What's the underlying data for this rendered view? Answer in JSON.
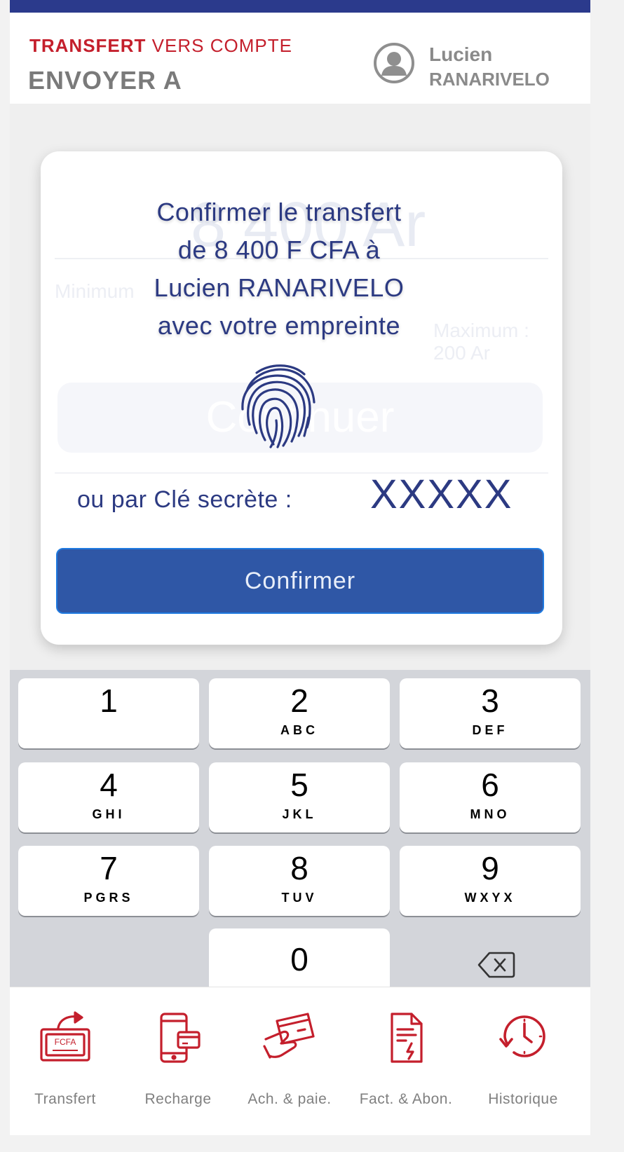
{
  "header": {
    "title_strong": "TRANSFERT",
    "title_light": "VERS COMPTE",
    "subtitle": "ENVOYER A",
    "recipient_first": "Lucien",
    "recipient_last": "RANARIVELO"
  },
  "modal": {
    "confirm_line1": "Confirmer le transfert",
    "confirm_line2": "de 8 400 F CFA à",
    "confirm_line3": "Lucien RANARIVELO",
    "confirm_line4": "avec votre empreinte",
    "secret_label": "ou par Clé secrète :",
    "secret_value": "XXXXX",
    "confirm_button": "Confirmer"
  },
  "background_form": {
    "amount_text": "8 400 Ar",
    "min_text": "Minimum",
    "max_text": "Maximum : 200 Ar",
    "continue_button": "Continuer"
  },
  "keypad": {
    "keys": [
      {
        "num": "1",
        "letters": ""
      },
      {
        "num": "2",
        "letters": "ABC"
      },
      {
        "num": "3",
        "letters": "DEF"
      },
      {
        "num": "4",
        "letters": "GHI"
      },
      {
        "num": "5",
        "letters": "JKL"
      },
      {
        "num": "6",
        "letters": "MNO"
      },
      {
        "num": "7",
        "letters": "PGRS"
      },
      {
        "num": "8",
        "letters": "TUV"
      },
      {
        "num": "9",
        "letters": "WXYX"
      },
      {
        "num": "0",
        "letters": ""
      }
    ],
    "delete_icon": "backspace-icon"
  },
  "tabbar": {
    "items": [
      {
        "label": "Transfert",
        "icon": "transfer-fcfa-icon",
        "icon_text": "FCFA"
      },
      {
        "label": "Recharge",
        "icon": "phone-recharge-icon"
      },
      {
        "label": "Ach. & paie.",
        "icon": "card-payment-icon"
      },
      {
        "label": "Fact. & Abon.",
        "icon": "invoice-icon"
      },
      {
        "label": "Historique",
        "icon": "history-clock-icon"
      }
    ]
  },
  "colors": {
    "brand_red": "#c41f2c",
    "brand_blue": "#2c3a82",
    "button_blue": "#2f57a6",
    "topbar": "#2b3a8c"
  }
}
